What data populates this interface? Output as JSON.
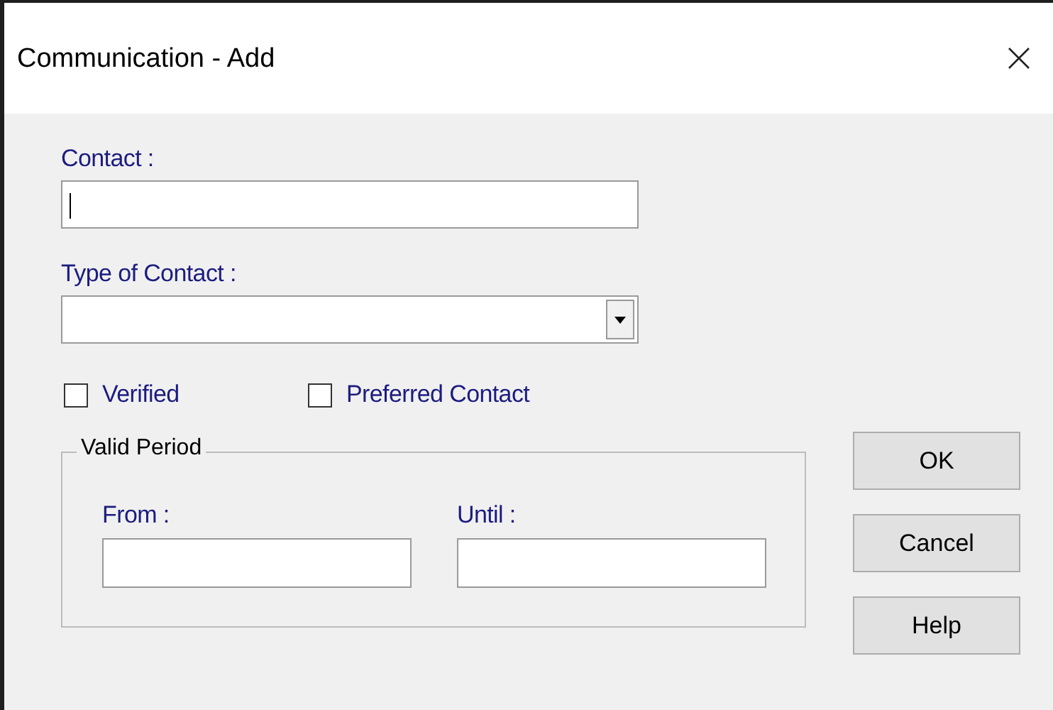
{
  "window": {
    "title": "Communication - Add"
  },
  "contact": {
    "label": "Contact :",
    "focused": true
  },
  "type_of_contact": {
    "label": "Type of Contact :"
  },
  "checkboxes": [
    {
      "label": "Verified",
      "checked": false
    },
    {
      "label": "Preferred Contact",
      "checked": false
    }
  ],
  "valid_period": {
    "title": "Valid Period",
    "from": {
      "label": "From :"
    },
    "until": {
      "label": "Until :"
    }
  },
  "buttons": [
    {
      "label": "OK"
    },
    {
      "label": "Cancel"
    },
    {
      "label": "Help"
    }
  ]
}
